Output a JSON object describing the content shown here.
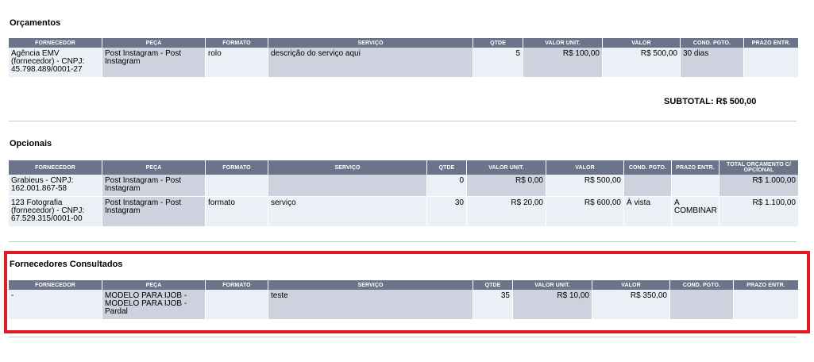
{
  "orcamentos": {
    "title": "Orçamentos",
    "headers": [
      "FORNECEDOR",
      "PEÇA",
      "FORMATO",
      "SERVIÇO",
      "QTDE",
      "VALOR UNIT.",
      "VALOR",
      "COND. PGTO.",
      "PRAZO ENTR."
    ],
    "rows": [
      [
        "Agência EMV (fornecedor) - CNPJ: 45.798.489/0001-27",
        "Post Instagram - Post Instagram",
        "rolo",
        "descrição do serviço aqui",
        "5",
        "R$ 100,00",
        "R$ 500,00",
        "30 dias",
        ""
      ]
    ],
    "subtotal": "SUBTOTAL: R$ 500,00"
  },
  "opcionais": {
    "title": "Opcionais",
    "headers": [
      "FORNECEDOR",
      "PEÇA",
      "FORMATO",
      "SERVIÇO",
      "QTDE",
      "VALOR UNIT.",
      "VALOR",
      "COND. PGTO.",
      "PRAZO ENTR.",
      "TOTAL ORÇAMENTO C/ OPCIONAL"
    ],
    "rows": [
      [
        "Grabieus - CNPJ: 162.001.867-58",
        "Post Instagram - Post Instagram",
        "",
        "",
        "0",
        "R$ 0,00",
        "R$ 500,00",
        "",
        "",
        "R$ 1.000,00"
      ],
      [
        "123 Fotografia (fornecedor) - CNPJ: 67.529.315/0001-00",
        "Post Instagram - Post Instagram",
        "formato",
        "serviço",
        "30",
        "R$ 20,00",
        "R$ 600,00",
        "À vista",
        "A COMBINAR",
        "R$ 1.100,00"
      ]
    ]
  },
  "consultados": {
    "title": "Fornecedores Consultados",
    "headers": [
      "FORNECEDOR",
      "PEÇA",
      "FORMATO",
      "SERVIÇO",
      "QTDE",
      "VALOR UNIT.",
      "VALOR",
      "COND. PGTO.",
      "PRAZO ENTR."
    ],
    "rows": [
      [
        "-",
        "MODELO PARA IJOB - MODELO PARA IJOB - Pardal",
        "",
        "teste",
        "35",
        "R$ 10,00",
        "R$ 350,00",
        "",
        ""
      ]
    ]
  },
  "colors": {
    "header_bg": "#6b7489",
    "cell_light": "#edeff6",
    "cell_dark": "#cdd2de",
    "highlight_border": "#e21b23"
  }
}
